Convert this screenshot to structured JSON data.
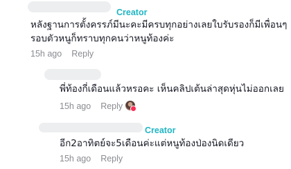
{
  "comments": [
    {
      "creator_badge": "Creator",
      "text_line1": "หลังฐานการตั้งครรภ์มีนะคะมีครบทุกอย่างเลยใบรับรองก็มีเพื่อนๆ",
      "text_line2": "รอบตัวหนูก็ทราบทุกคนว่าหนูท้องค่ะ",
      "time": "15h ago",
      "reply_label": "Reply"
    },
    {
      "text_line1": "พี่ท้องกี่เดือนแล้วหรอคะ เห็นคลิปเต้นล่าสุดหุ่นไม่ออกเลย",
      "time": "15h ago",
      "reply_label": "Reply"
    },
    {
      "creator_badge": "Creator",
      "text_line1": "อีก2อาทิตย์จะ5เดือนค่ะแต่หนูท้องป่องนิดเดียว",
      "time": "15h ago",
      "reply_label": "Reply"
    }
  ],
  "colors": {
    "creator_badge": "#20b5c3",
    "text": "#161823",
    "meta": "#8a8b91",
    "like_dot": "#fe2c55"
  }
}
